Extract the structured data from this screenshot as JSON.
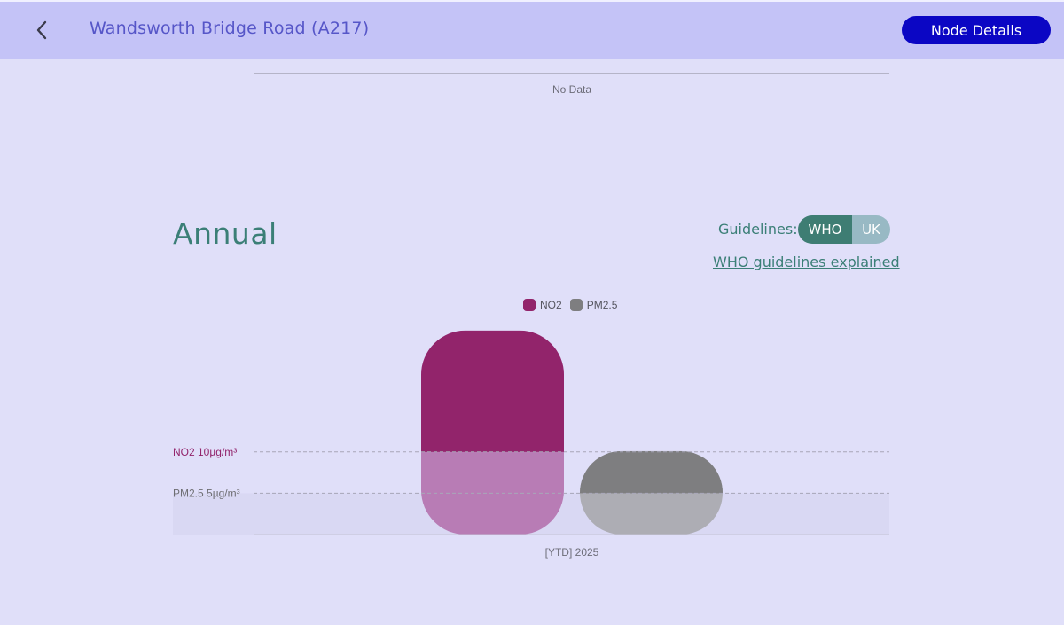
{
  "header": {
    "title": "Wandsworth Bridge Road (A217)",
    "node_button": "Node Details",
    "back_icon": "chevron-left-icon"
  },
  "top_chart": {
    "no_data": "No Data"
  },
  "annual": {
    "title": "Annual",
    "guidelines_label": "Guidelines:",
    "toggle": {
      "options": [
        "WHO",
        "UK"
      ],
      "selected": "WHO"
    },
    "link": "WHO guidelines explained"
  },
  "chart_data": {
    "type": "bar",
    "categories": [
      "[YTD] 2025"
    ],
    "series": [
      {
        "name": "NO2",
        "values": [
          24.7
        ]
      },
      {
        "name": "PM2.5",
        "values": [
          10.1
        ]
      }
    ],
    "guidelines": [
      {
        "label": "NO2 10µg/m³",
        "value": 10
      },
      {
        "label": "PM2.5 5µg/m³",
        "value": 5
      }
    ],
    "ylim": [
      0,
      25
    ],
    "grid": false,
    "legend": "top-center"
  },
  "colors": {
    "no2": "#92246b",
    "no2_below": "#b87cb5",
    "pm25": "#7e7e80",
    "pm25_below": "#adadb4",
    "guideline_no2_text": "#92246b",
    "guideline_pm25_text": "#6e6e72",
    "accent": "#0b06c4",
    "teal": "#3b7f77"
  }
}
